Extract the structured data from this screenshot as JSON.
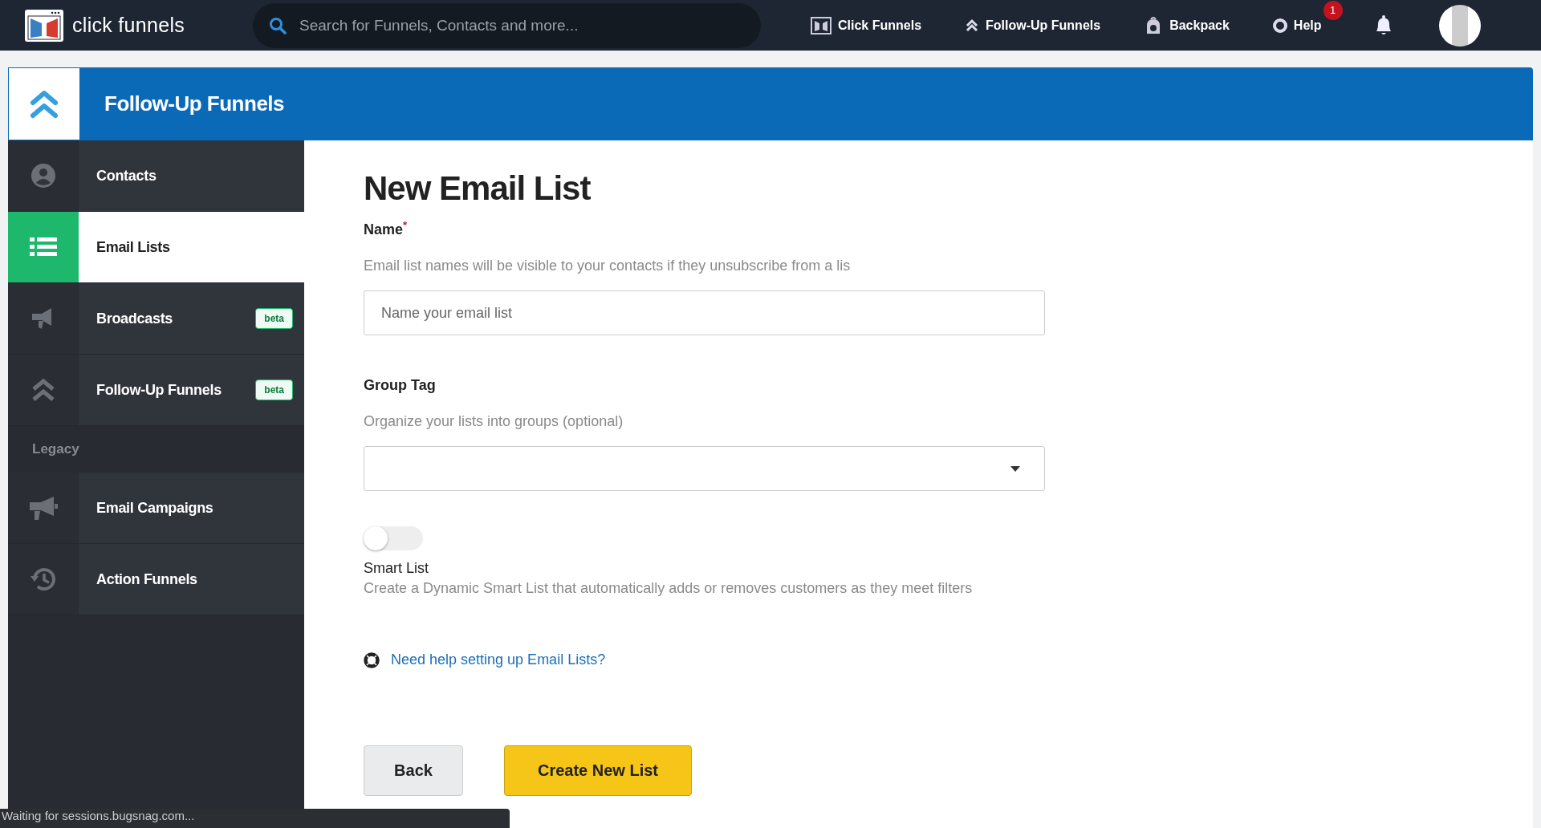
{
  "topbar": {
    "logo_text": "click funnels",
    "search": {
      "placeholder": "Search for Funnels, Contacts and more..."
    },
    "nav": [
      {
        "kind": "cf",
        "label": "Click Funnels"
      },
      {
        "kind": "chevrons",
        "label": "Follow-Up Funnels"
      },
      {
        "kind": "backpack",
        "label": "Backpack"
      },
      {
        "kind": "help",
        "label": "Help",
        "badge": "1"
      }
    ]
  },
  "header": {
    "title": "Follow-Up Funnels"
  },
  "sidebar": {
    "items": [
      {
        "kind": "contacts",
        "label": "Contacts",
        "selected": false
      },
      {
        "kind": "list",
        "label": "Email Lists",
        "selected": true
      },
      {
        "kind": "broadcast",
        "label": "Broadcasts",
        "selected": false,
        "badge": "beta"
      },
      {
        "kind": "chevrons",
        "label": "Follow-Up Funnels",
        "selected": false,
        "badge": "beta"
      }
    ],
    "section": "Legacy",
    "legacy_items": [
      {
        "kind": "megaphone",
        "label": "Email Campaigns",
        "selected": false
      },
      {
        "kind": "history",
        "label": "Action Funnels",
        "selected": false
      }
    ]
  },
  "form": {
    "title": "New Email List",
    "name_field": {
      "label": "Name",
      "required_mark": "*",
      "hint": "Email list names will be visible to your contacts if they unsubscribe from a lis",
      "placeholder": "Name your email list"
    },
    "group_field": {
      "label": "Group Tag",
      "hint": "Organize your lists into groups (optional)"
    },
    "smart_list": {
      "on": false,
      "label": "Smart List",
      "description": "Create a Dynamic Smart List that automatically adds or removes customers as they meet filters"
    },
    "help_link": "Need help setting up Email Lists?",
    "buttons": [
      {
        "kind": "secondary",
        "label": "Back"
      },
      {
        "kind": "primary",
        "label": "Create New List"
      }
    ]
  },
  "status_bar": "Waiting for sessions.bugsnag.com..."
}
